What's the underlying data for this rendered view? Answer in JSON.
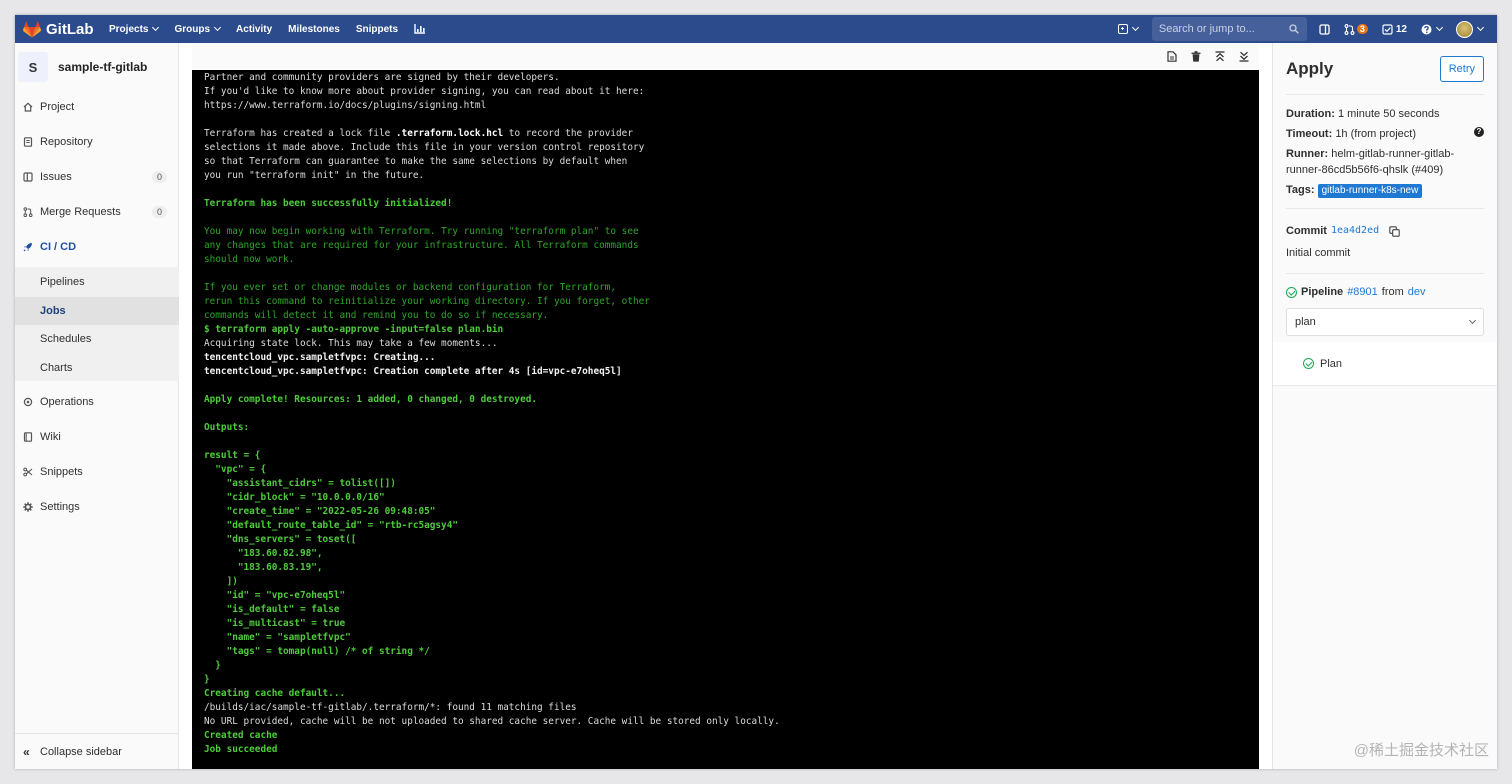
{
  "topbar": {
    "brand": "GitLab",
    "nav": [
      "Projects",
      "Groups",
      "Activity",
      "Milestones",
      "Snippets"
    ],
    "nav_dropdown": [
      true,
      true,
      false,
      false,
      false
    ],
    "search_placeholder": "Search or jump to...",
    "merge_requests_count": "3",
    "todos_count": "12"
  },
  "sidebar": {
    "project_initial": "S",
    "project_name": "sample-tf-gitlab",
    "items": [
      {
        "label": "Project",
        "icon": "home-icon"
      },
      {
        "label": "Repository",
        "icon": "doc-icon"
      },
      {
        "label": "Issues",
        "icon": "issues-icon",
        "count": "0"
      },
      {
        "label": "Merge Requests",
        "icon": "merge-request-icon",
        "count": "0"
      },
      {
        "label": "CI / CD",
        "icon": "rocket-icon"
      }
    ],
    "cicd_sub": [
      "Pipelines",
      "Jobs",
      "Schedules",
      "Charts"
    ],
    "items_after": [
      {
        "label": "Operations",
        "icon": "cloud-gear-icon"
      },
      {
        "label": "Wiki",
        "icon": "book-icon"
      },
      {
        "label": "Snippets",
        "icon": "scissors-icon"
      },
      {
        "label": "Settings",
        "icon": "gear-icon"
      }
    ],
    "collapse_label": "Collapse sidebar"
  },
  "log": {
    "lines": [
      {
        "t": "Partner and community providers are signed by their developers.",
        "s": "white"
      },
      {
        "t": "If you'd like to know more about provider signing, you can read about it here:",
        "s": "white"
      },
      {
        "t": "https://www.terraform.io/docs/plugins/signing.html",
        "s": "white"
      },
      {
        "t": "",
        "s": "white"
      },
      {
        "t": "Terraform has created a lock file .terraform.lock.hcl to record the provider",
        "s": "white"
      },
      {
        "t": "selections it made above. Include this file in your version control repository",
        "s": "white"
      },
      {
        "t": "so that Terraform can guarantee to make the same selections by default when",
        "s": "white"
      },
      {
        "t": "you run \"terraform init\" in the future.",
        "s": "white"
      },
      {
        "t": "",
        "s": "white"
      },
      {
        "t": "Terraform has been successfully initialized!",
        "s": "green"
      },
      {
        "t": "",
        "s": "white"
      },
      {
        "t": "You may now begin working with Terraform. Try running \"terraform plan\" to see",
        "s": "dgreen"
      },
      {
        "t": "any changes that are required for your infrastructure. All Terraform commands",
        "s": "dgreen"
      },
      {
        "t": "should now work.",
        "s": "dgreen"
      },
      {
        "t": "",
        "s": "white"
      },
      {
        "t": "If you ever set or change modules or backend configuration for Terraform,",
        "s": "dgreen"
      },
      {
        "t": "rerun this command to reinitialize your working directory. If you forget, other",
        "s": "dgreen"
      },
      {
        "t": "commands will detect it and remind you to do so if necessary.",
        "s": "dgreen"
      },
      {
        "t": "$ terraform apply -auto-approve -input=false plan.bin",
        "s": "green"
      },
      {
        "t": "Acquiring state lock. This may take a few moments...",
        "s": "white"
      },
      {
        "t": "tencentcloud_vpc.sampletfvpc: Creating...",
        "s": "bold"
      },
      {
        "t": "tencentcloud_vpc.sampletfvpc: Creation complete after 4s [id=vpc-e7oheq5l]",
        "s": "bold"
      },
      {
        "t": "",
        "s": "white"
      },
      {
        "t": "Apply complete! Resources: 1 added, 0 changed, 0 destroyed.",
        "s": "green"
      },
      {
        "t": "",
        "s": "white"
      },
      {
        "t": "Outputs:",
        "s": "green"
      },
      {
        "t": "",
        "s": "white"
      },
      {
        "t": "result = {",
        "s": "green"
      },
      {
        "t": "  \"vpc\" = {",
        "s": "green"
      },
      {
        "t": "    \"assistant_cidrs\" = tolist([])",
        "s": "green"
      },
      {
        "t": "    \"cidr_block\" = \"10.0.0.0/16\"",
        "s": "green"
      },
      {
        "t": "    \"create_time\" = \"2022-05-26 09:48:05\"",
        "s": "green"
      },
      {
        "t": "    \"default_route_table_id\" = \"rtb-rc5agsy4\"",
        "s": "green"
      },
      {
        "t": "    \"dns_servers\" = toset([",
        "s": "green"
      },
      {
        "t": "      \"183.60.82.98\",",
        "s": "green"
      },
      {
        "t": "      \"183.60.83.19\",",
        "s": "green"
      },
      {
        "t": "    ])",
        "s": "green"
      },
      {
        "t": "    \"id\" = \"vpc-e7oheq5l\"",
        "s": "green"
      },
      {
        "t": "    \"is_default\" = false",
        "s": "green"
      },
      {
        "t": "    \"is_multicast\" = true",
        "s": "green"
      },
      {
        "t": "    \"name\" = \"sampletfvpc\"",
        "s": "green"
      },
      {
        "t": "    \"tags\" = tomap(null) /* of string */",
        "s": "green"
      },
      {
        "t": "  }",
        "s": "green"
      },
      {
        "t": "}",
        "s": "green"
      },
      {
        "t": "Creating cache default...",
        "s": "green"
      },
      {
        "t": "/builds/iac/sample-tf-gitlab/.terraform/*: found 11 matching files",
        "s": "white"
      },
      {
        "t": "No URL provided, cache will be not uploaded to shared cache server. Cache will be stored only locally.",
        "s": "white"
      },
      {
        "t": "Created cache",
        "s": "green"
      },
      {
        "t": "Job succeeded",
        "s": "green"
      }
    ]
  },
  "job": {
    "title": "Apply",
    "retry_label": "Retry",
    "duration_label": "Duration:",
    "duration": "1 minute 50 seconds",
    "timeout_label": "Timeout:",
    "timeout": "1h (from project)",
    "runner_label": "Runner:",
    "runner": "helm-gitlab-runner-gitlab-runner-86cd5b56f6-qhslk (#409)",
    "tags_label": "Tags:",
    "tag": "gitlab-runner-k8s-new",
    "commit_label": "Commit",
    "commit_sha": "1ea4d2ed",
    "commit_message": "Initial commit",
    "pipeline_label": "Pipeline",
    "pipeline_id": "#8901",
    "pipeline_from": "from",
    "branch": "dev",
    "stage": "plan",
    "stage_job": "Plan"
  },
  "watermark": "@稀土掘金技术社区",
  "colors": {
    "topbar": "#2c4b8c",
    "link": "#1f78d1",
    "log_green": "#4ecc3b",
    "success": "#1aaa55"
  }
}
